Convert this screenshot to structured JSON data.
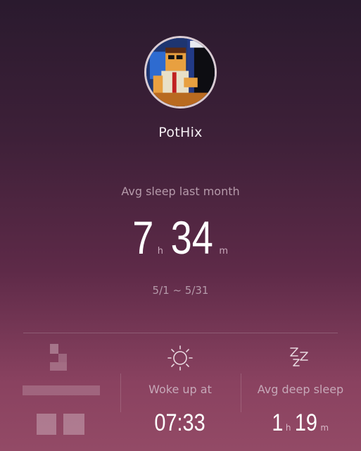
{
  "profile": {
    "username": "PotHix",
    "avatar_icon": "pixel-art-avatar-icon"
  },
  "summary": {
    "label": "Avg sleep last month",
    "hours": "7",
    "hours_unit": "h",
    "minutes": "34",
    "minutes_unit": "m",
    "date_range": "5/1 ~ 5/31"
  },
  "stats": [
    {
      "icon": "blurred-icon",
      "label": "",
      "value": ""
    },
    {
      "icon": "sun-icon",
      "label": "Woke up at",
      "value": "07:33"
    },
    {
      "icon": "zzz-icon",
      "label": "Avg deep sleep",
      "hours": "1",
      "hours_unit": "h",
      "minutes": "19",
      "minutes_unit": "m"
    }
  ],
  "colors": {
    "background_top": "#2a1a2e",
    "background_bottom": "#934a66",
    "muted_text": "#b59aaa"
  }
}
